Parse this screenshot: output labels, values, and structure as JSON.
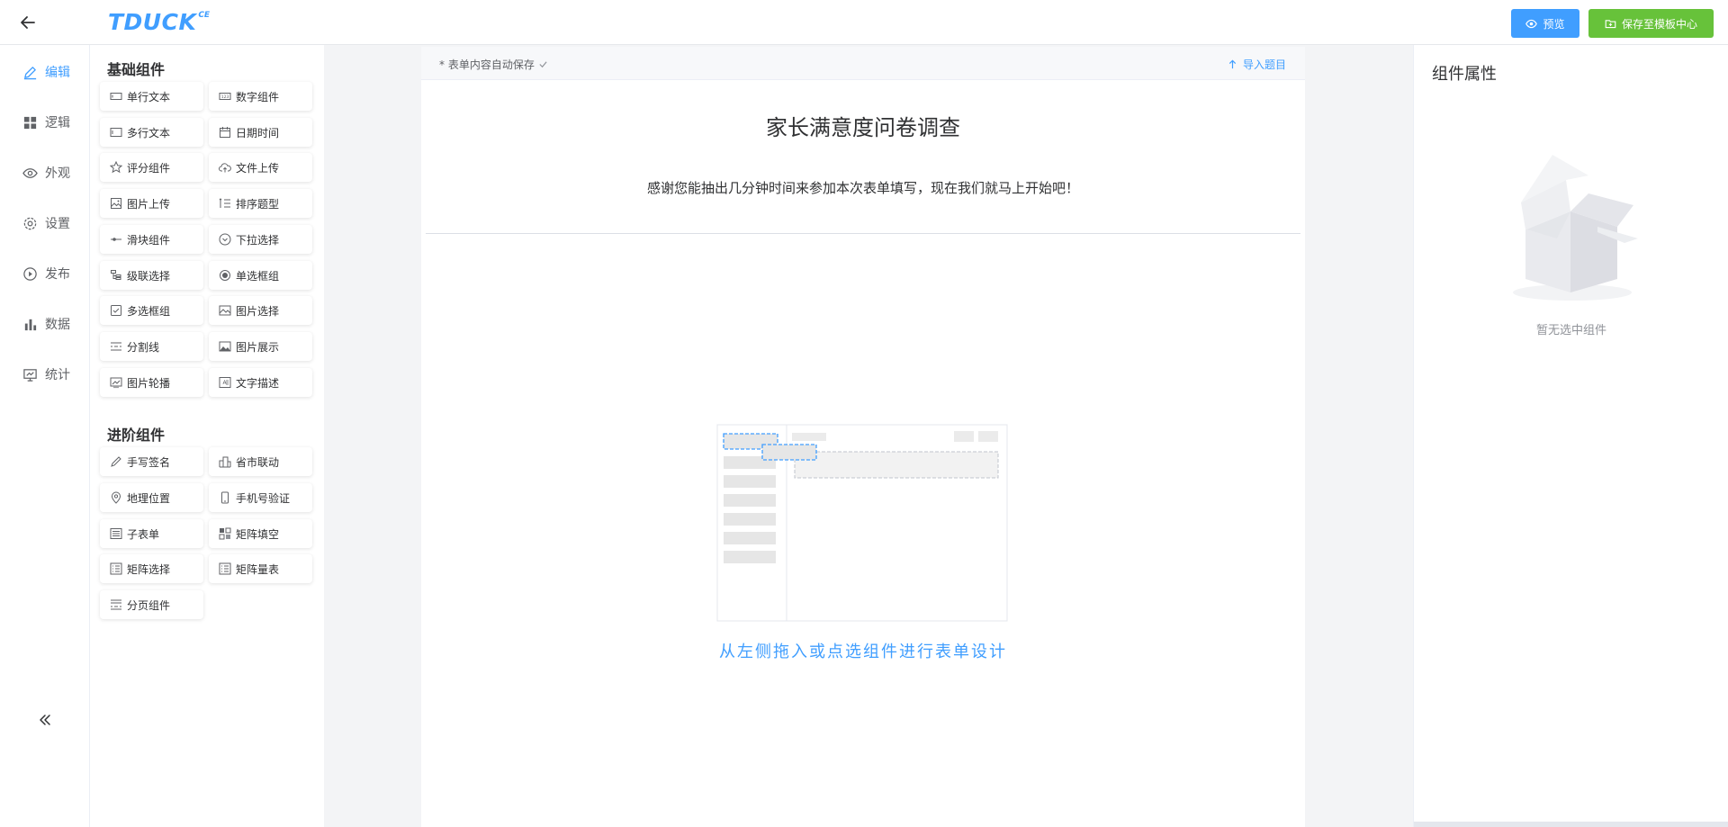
{
  "header": {
    "logo_text": "TDUCK",
    "logo_sup": "CE",
    "preview_label": "预览",
    "save_template_label": "保存至模板中心"
  },
  "leftnav": {
    "items": [
      {
        "label": "编辑",
        "icon": "edit-icon",
        "active": true
      },
      {
        "label": "逻辑",
        "icon": "grid-icon",
        "active": false
      },
      {
        "label": "外观",
        "icon": "eye-icon",
        "active": false
      },
      {
        "label": "设置",
        "icon": "gear-icon",
        "active": false
      },
      {
        "label": "发布",
        "icon": "play-circle-icon",
        "active": false
      },
      {
        "label": "数据",
        "icon": "bar-chart-icon",
        "active": false
      },
      {
        "label": "统计",
        "icon": "statistics-icon",
        "active": false
      }
    ]
  },
  "components": {
    "basic_title": "基础组件",
    "basic": [
      {
        "label": "单行文本",
        "icon": "input-icon"
      },
      {
        "label": "数字组件",
        "icon": "number-icon"
      },
      {
        "label": "多行文本",
        "icon": "textarea-icon"
      },
      {
        "label": "日期时间",
        "icon": "calendar-icon"
      },
      {
        "label": "评分组件",
        "icon": "star-icon"
      },
      {
        "label": "文件上传",
        "icon": "cloud-upload-icon"
      },
      {
        "label": "图片上传",
        "icon": "image-upload-icon"
      },
      {
        "label": "排序题型",
        "icon": "sort-icon"
      },
      {
        "label": "滑块组件",
        "icon": "slider-icon"
      },
      {
        "label": "下拉选择",
        "icon": "dropdown-icon"
      },
      {
        "label": "级联选择",
        "icon": "cascader-icon"
      },
      {
        "label": "单选框组",
        "icon": "radio-icon"
      },
      {
        "label": "多选框组",
        "icon": "checkbox-icon"
      },
      {
        "label": "图片选择",
        "icon": "image-select-icon"
      },
      {
        "label": "分割线",
        "icon": "divider-icon"
      },
      {
        "label": "图片展示",
        "icon": "image-display-icon"
      },
      {
        "label": "图片轮播",
        "icon": "carousel-icon"
      },
      {
        "label": "文字描述",
        "icon": "text-desc-icon"
      }
    ],
    "advanced_title": "进阶组件",
    "advanced": [
      {
        "label": "手写签名",
        "icon": "signature-icon"
      },
      {
        "label": "省市联动",
        "icon": "city-icon"
      },
      {
        "label": "地理位置",
        "icon": "location-icon"
      },
      {
        "label": "手机号验证",
        "icon": "phone-icon"
      },
      {
        "label": "子表单",
        "icon": "subform-icon"
      },
      {
        "label": "矩阵填空",
        "icon": "matrix-fill-icon"
      },
      {
        "label": "矩阵选择",
        "icon": "matrix-select-icon"
      },
      {
        "label": "矩阵量表",
        "icon": "matrix-scale-icon"
      },
      {
        "label": "分页组件",
        "icon": "pagination-icon"
      }
    ]
  },
  "canvas": {
    "autosave_text": "* 表单内容自动保存",
    "import_label": "导入题目",
    "form_title": "家长满意度问卷调查",
    "form_description": "感谢您能抽出几分钟时间来参加本次表单填写，现在我们就马上开始吧！",
    "empty_hint": "从左侧拖入或点选组件进行表单设计"
  },
  "right_panel": {
    "title": "组件属性",
    "empty_text": "暂无选中组件"
  },
  "colors": {
    "primary": "#409eff",
    "success": "#67c23a"
  }
}
